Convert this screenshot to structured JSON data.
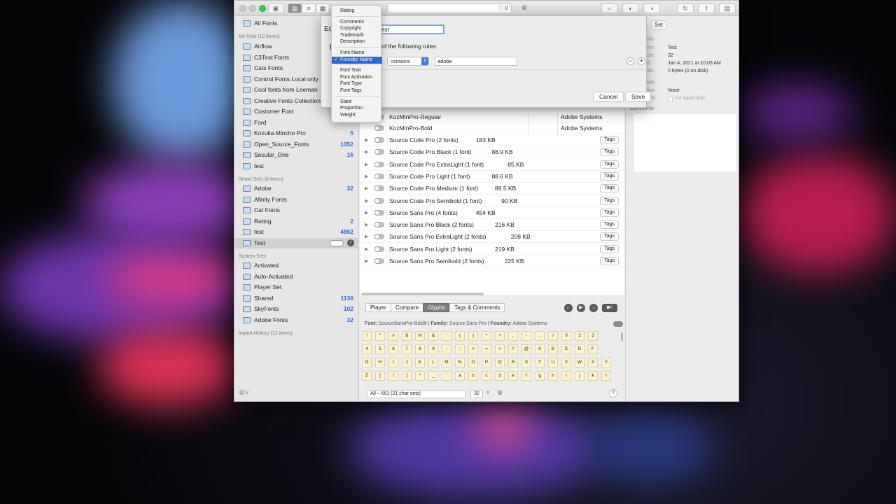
{
  "window": {
    "search_count": "0"
  },
  "sidebar": {
    "all_fonts": "All Fonts",
    "my_sets_header": "My Sets (12 items)",
    "my_sets": [
      {
        "label": "Airflow",
        "count": ""
      },
      {
        "label": "C3Test Fonts",
        "count": ""
      },
      {
        "label": "Cats Fonts",
        "count": ""
      },
      {
        "label": "Control Fonts Local only",
        "count": ""
      },
      {
        "label": "Cool fonts from Leeman",
        "count": ""
      },
      {
        "label": "Creative Fonts Collection...",
        "count": ""
      },
      {
        "label": "Customer Font",
        "count": ""
      },
      {
        "label": "Ford",
        "count": ""
      },
      {
        "label": "Kozuka Mincho Pro",
        "count": "5"
      },
      {
        "label": "Open_Source_Fonts",
        "count": "1352"
      },
      {
        "label": "Secular_One",
        "count": "16"
      },
      {
        "label": "test",
        "count": ""
      }
    ],
    "smart_sets_header": "Smart Sets (6 items)",
    "smart_sets": [
      {
        "label": "Adobe",
        "count": "32"
      },
      {
        "label": "Afinity Fonts",
        "count": ""
      },
      {
        "label": "Cat Fonts",
        "count": ""
      },
      {
        "label": "Rating",
        "count": "2"
      },
      {
        "label": "test",
        "count": "4862"
      },
      {
        "label": "Test",
        "count": ""
      }
    ],
    "system_sets_header": "System Sets",
    "system_sets": [
      {
        "label": "Activated",
        "count": ""
      },
      {
        "label": "Auto-Activated",
        "count": ""
      },
      {
        "label": "Player Set",
        "count": ""
      },
      {
        "label": "Shared",
        "count": "1136"
      },
      {
        "label": "SkyFonts",
        "count": "102"
      },
      {
        "label": "Adobe Fonts",
        "count": "32"
      }
    ],
    "import_history_header": "Import History (12 items)"
  },
  "font_list": {
    "rows": [
      {
        "name": "KozMinPro-Regular",
        "size": "",
        "foundry": "Adobe Systems",
        "expandable": false,
        "tags": ""
      },
      {
        "name": "KozMinPro-Bold",
        "size": "",
        "foundry": "Adobe Systems",
        "expandable": false,
        "tags": ""
      },
      {
        "name": "Source Code Pro (2 fonts)",
        "size": "183 KB",
        "foundry": "",
        "expandable": true,
        "tags": "Tags"
      },
      {
        "name": "Source Code Pro Black (1 font)",
        "size": "88.9 KB",
        "foundry": "",
        "expandable": true,
        "tags": "Tags"
      },
      {
        "name": "Source Code Pro ExtraLight (1 font)",
        "size": "85 KB",
        "foundry": "",
        "expandable": true,
        "tags": "Tags"
      },
      {
        "name": "Source Code Pro Light (1 font)",
        "size": "88.6 KB",
        "foundry": "",
        "expandable": true,
        "tags": "Tags"
      },
      {
        "name": "Source Code Pro Medium (1 font)",
        "size": "89.5 KB",
        "foundry": "",
        "expandable": true,
        "tags": "Tags"
      },
      {
        "name": "Source Code Pro Semibold (1 font)",
        "size": "90 KB",
        "foundry": "",
        "expandable": true,
        "tags": "Tags"
      },
      {
        "name": "Source Sans Pro (4 fonts)",
        "size": "454 KB",
        "foundry": "",
        "expandable": true,
        "tags": "Tags"
      },
      {
        "name": "Source Sans Pro Black (2 fonts)",
        "size": "216 KB",
        "foundry": "",
        "expandable": true,
        "tags": "Tags"
      },
      {
        "name": "Source Sans Pro ExtraLight (2 fonts)",
        "size": "208 KB",
        "foundry": "",
        "expandable": true,
        "tags": "Tags"
      },
      {
        "name": "Source Sans Pro Light (2 fonts)",
        "size": "219 KB",
        "foundry": "",
        "expandable": true,
        "tags": "Tags"
      },
      {
        "name": "Source Sans Pro Semibold (2 fonts)",
        "size": "225 KB",
        "foundry": "",
        "expandable": true,
        "tags": "Tags"
      }
    ]
  },
  "bottom_pane": {
    "tabs": [
      "Player",
      "Compare",
      "Glyphs",
      "Tags & Comments"
    ],
    "active_tab": "Glyphs",
    "info": {
      "font_label": "Font:",
      "font_value": "SourceSansPro-BoldIt",
      "family_label": "Family:",
      "family_value": "Source Sans Pro",
      "foundry_label": "Foundry:",
      "foundry_value": "Adobe Systems"
    },
    "glyphs": [
      "!",
      "\"",
      "#",
      "$",
      "%",
      "&",
      "'",
      "(",
      ")",
      "*",
      "+",
      ",",
      "-",
      ".",
      "/",
      "0",
      "2",
      "3",
      "4",
      "5",
      "6",
      "7",
      "8",
      "9",
      ":",
      ";",
      "<",
      "=",
      ">",
      "?",
      "@",
      "A",
      "B",
      "C",
      "E",
      "F",
      "G",
      "H",
      "I",
      "J",
      "K",
      "L",
      "M",
      "N",
      "O",
      "P",
      "Q",
      "R",
      "S",
      "T",
      "U",
      "V",
      "W",
      "X",
      "Y",
      "Z",
      "[",
      "\\",
      "]",
      "^",
      "_",
      "`",
      "a",
      "b",
      "c",
      "d",
      "e",
      "f",
      "g",
      "h",
      "i",
      "j",
      "k",
      "l"
    ],
    "charset_select": "All – 661 (21 char sets)",
    "glyph_size": "32",
    "help": "?"
  },
  "inspector": {
    "set_button": "Set",
    "section_info": "nfo",
    "name_label": "me:",
    "name_value": "Test",
    "count_label": "unt:",
    "count_value": "32",
    "date_label": "d:",
    "date_value": "Jan 4, 2021 at 10:06 AM",
    "size_label": "ize:",
    "size_value": "0 bytes (0 on disk)",
    "section_info2": "Info",
    "active_label": "tive:",
    "active_value": "None",
    "set_label": "Set:",
    "set_value": "not applicable",
    "comments_label": "Comments"
  },
  "sheet": {
    "title": "Ec",
    "name_value": "est",
    "rules_text": "of the following rules:",
    "operator": "contains",
    "value": "adobe",
    "minus": "−",
    "plus": "+",
    "cancel": "Cancel",
    "save": "Save"
  },
  "menu": {
    "groups": [
      [
        "Rating"
      ],
      [
        "Comments",
        "Copyright",
        "Trademark",
        "Description"
      ],
      [
        "Font Name",
        "Foundry Name"
      ],
      [
        "Font Trait",
        "Font Activation",
        "Font Type",
        "Font Tags"
      ],
      [
        "Slant",
        "Proportion",
        "Weight"
      ]
    ],
    "selected": "Foundry Name",
    "check": "✓"
  },
  "colors": {
    "accent": "#2f66d8",
    "count_blue": "#2f6fd1",
    "glyph_bg": "#fbf3d2"
  }
}
